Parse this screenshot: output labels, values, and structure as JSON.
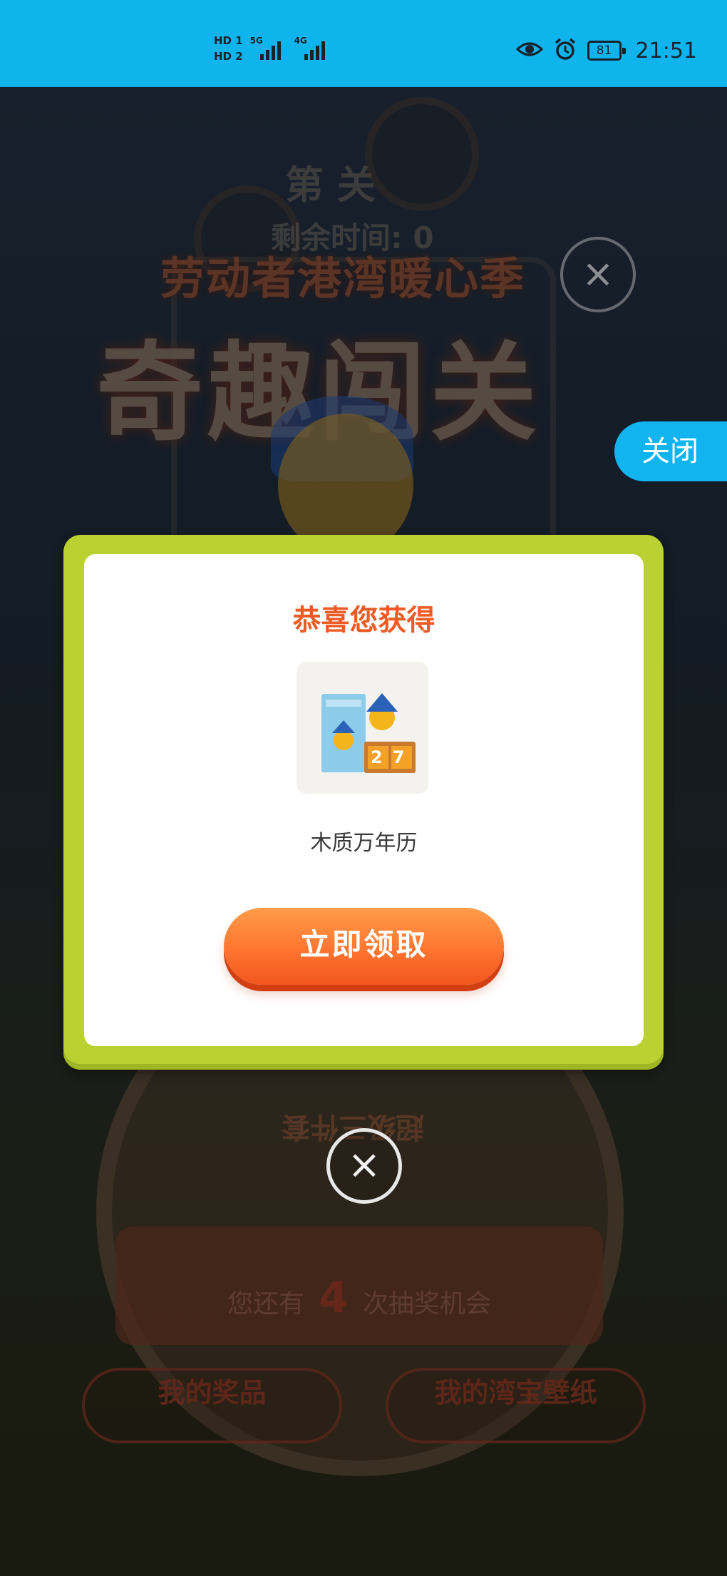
{
  "status_bar": {
    "sim1_label": "HD 1",
    "sim2_label": "HD 2",
    "network1": "5G",
    "network2": "4G",
    "battery": "81",
    "time": "21:51",
    "icons": [
      "eye-icon",
      "alarm-icon",
      "battery-icon"
    ]
  },
  "background": {
    "level_label": "第 关",
    "time_remaining": "剩余时间: 0",
    "title_sub": "劳动者港湾暖心季",
    "title_main": "奇趣闯关",
    "wheel_text": "超级三件套",
    "chances_prefix": "您还有",
    "chances_count": "4",
    "chances_suffix": "次抽奖机会",
    "btn_my_prizes": "我的奖品",
    "btn_my_wallpaper": "我的湾宝壁纸",
    "close_label": "关闭"
  },
  "modal": {
    "title": "恭喜您获得",
    "prize_name": "木质万年历",
    "prize_image_digits": "27",
    "claim_button": "立即领取"
  },
  "colors": {
    "status_bar": "#10b4ec",
    "modal_border": "#b9d232",
    "title_orange": "#ee5b24",
    "button_orange": "#ff7530",
    "side_close_blue": "#11b4ee"
  }
}
